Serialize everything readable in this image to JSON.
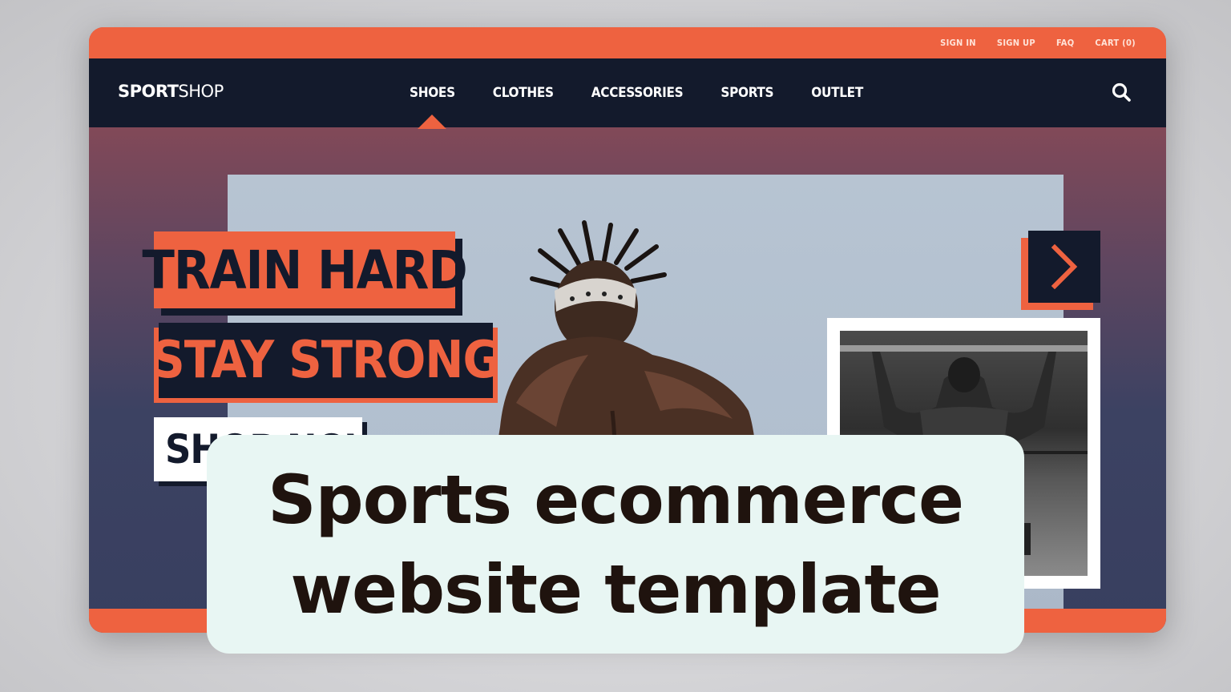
{
  "utility_bar": {
    "links": [
      "SIGN IN",
      "SIGN UP",
      "FAQ",
      "CART (0)"
    ]
  },
  "navbar": {
    "logo_bold": "SPORT",
    "logo_rest": "SHOP",
    "items": [
      {
        "label": "SHOES",
        "active": true
      },
      {
        "label": "CLOTHES",
        "active": false
      },
      {
        "label": "ACCESSORIES",
        "active": false
      },
      {
        "label": "SPORTS",
        "active": false
      },
      {
        "label": "OUTLET",
        "active": false
      }
    ],
    "search_icon": "search-icon"
  },
  "hero": {
    "headline_1": "TRAIN HARD",
    "headline_2": "STAY STRONG",
    "cta": "SHOP NOW",
    "next_icon": "chevron-right-icon"
  },
  "caption": {
    "line_1": "Sports ecommerce",
    "line_2": "website template"
  },
  "colors": {
    "accent": "#ee6240",
    "navy": "#131a2c",
    "caption_bg": "#e8f6f3",
    "caption_text": "#1f130e"
  }
}
